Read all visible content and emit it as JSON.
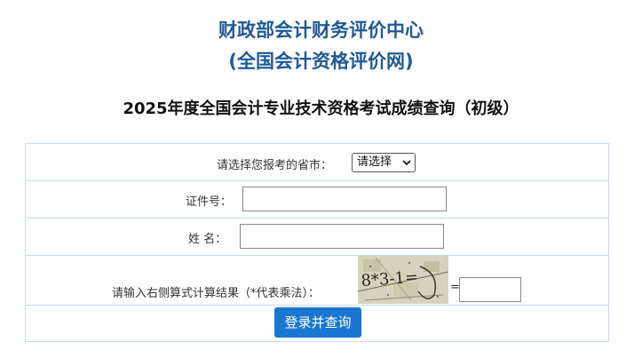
{
  "header": {
    "org_line1": "财政部会计财务评价中心",
    "org_line2": "(全国会计资格评价网)",
    "page_title": "2025年度全国会计专业技术资格考试成绩查询（初级）"
  },
  "form": {
    "province": {
      "label": "请选择您报考的省市：",
      "selected": "请选择"
    },
    "id_number": {
      "label": "证件号：",
      "value": ""
    },
    "name": {
      "label": "姓 名：",
      "value": ""
    },
    "captcha": {
      "label": "请输入右侧算式计算结果（*代表乘法）：",
      "image_text": "8*3-1=",
      "equals": "=",
      "value": ""
    },
    "submit_label": "登录并查询"
  },
  "colors": {
    "title_blue": "#1f5a96",
    "border": "#c6dcef",
    "button": "#1976d2"
  }
}
